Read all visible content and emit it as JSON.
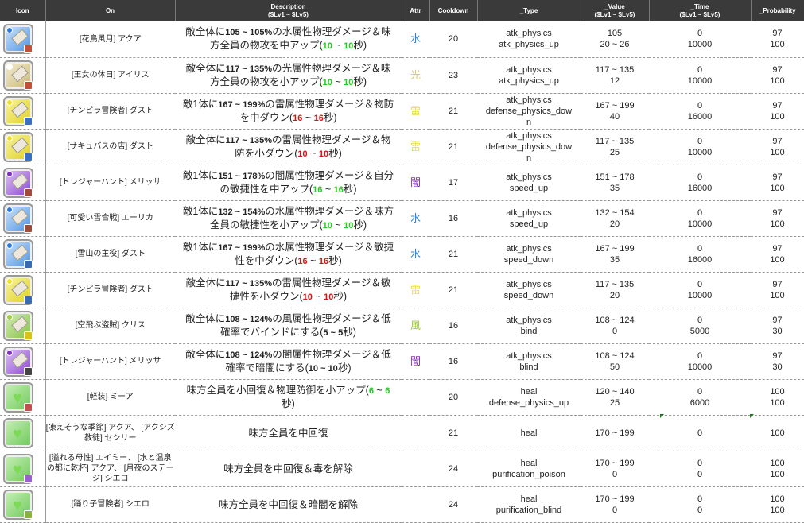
{
  "headers": {
    "icon": "Icon",
    "on": "On",
    "desc": "Description",
    "desc_sub": "($Lv1 ~ $Lv5)",
    "attr": "Attr",
    "cooldown": "Cooldown",
    "type": "_Type",
    "value": "_Value",
    "value_sub": "($Lv1 ~ $Lv5)",
    "time": "_Time",
    "time_sub": "($Lv1 ~ $Lv5)",
    "prob": "_Probability"
  },
  "colors": {
    "水": "#2e86d8",
    "光": "#d6c86a",
    "雷": "#ece040",
    "闇": "#8a2ec8",
    "風": "#9ccc3a",
    "heal": "#86d870"
  },
  "rows": [
    {
      "icon": "water",
      "badge": "#c0503a",
      "on": "[花鳥風月] アクア",
      "desc": [
        [
          "敵全体に",
          ""
        ],
        [
          "105 ~ 105%",
          "b"
        ],
        [
          "の水属性物理ダメージ＆味方全員の物攻を中アップ(",
          ""
        ],
        [
          "10",
          "g"
        ],
        [
          " ~ ",
          ""
        ],
        [
          "10",
          "g"
        ],
        [
          "秒)",
          ""
        ]
      ],
      "attr": "水",
      "cooldown": "20",
      "type": [
        "atk_physics",
        "atk_physics_up"
      ],
      "value": [
        "105",
        "20 ~ 26"
      ],
      "time": [
        "0",
        "10000"
      ],
      "prob": [
        "97",
        "100"
      ]
    },
    {
      "icon": "light",
      "badge": "#c0503a",
      "on": "[王女の休日] アイリス",
      "desc": [
        [
          "敵全体に",
          ""
        ],
        [
          "117 ~ 135%",
          "b"
        ],
        [
          "の光属性物理ダメージ＆味方全員の物攻を小アップ(",
          ""
        ],
        [
          "10",
          "g"
        ],
        [
          " ~ ",
          ""
        ],
        [
          "10",
          "g"
        ],
        [
          "秒)",
          ""
        ]
      ],
      "attr": "光",
      "cooldown": "23",
      "type": [
        "atk_physics",
        "atk_physics_up"
      ],
      "value": [
        "117 ~ 135",
        "12"
      ],
      "time": [
        "0",
        "10000"
      ],
      "prob": [
        "97",
        "100"
      ]
    },
    {
      "icon": "thunder",
      "badge": "#3a70c0",
      "on": "[チンピラ冒険者] ダスト",
      "desc": [
        [
          "敵1体に",
          ""
        ],
        [
          "167 ~ 199%",
          "b"
        ],
        [
          "の雷属性物理ダメージ＆物防を中ダウン(",
          ""
        ],
        [
          "16",
          "r"
        ],
        [
          " ~ ",
          ""
        ],
        [
          "16",
          "r"
        ],
        [
          "秒)",
          ""
        ]
      ],
      "attr": "雷",
      "cooldown": "21",
      "type": [
        "atk_physics",
        "defense_physics_dow",
        "n"
      ],
      "value": [
        "167 ~ 199",
        "40"
      ],
      "time": [
        "0",
        "16000"
      ],
      "prob": [
        "97",
        "100"
      ]
    },
    {
      "icon": "thunder",
      "badge": "#3a70c0",
      "on": "[サキュバスの店] ダスト",
      "desc": [
        [
          "敵全体に",
          ""
        ],
        [
          "117 ~ 135%",
          "b"
        ],
        [
          "の雷属性物理ダメージ＆物防を小ダウン(",
          ""
        ],
        [
          "10",
          "r"
        ],
        [
          " ~ ",
          ""
        ],
        [
          "10",
          "r"
        ],
        [
          "秒)",
          ""
        ]
      ],
      "attr": "雷",
      "cooldown": "21",
      "type": [
        "atk_physics",
        "defense_physics_dow",
        "n"
      ],
      "value": [
        "117 ~ 135",
        "25"
      ],
      "time": [
        "0",
        "10000"
      ],
      "prob": [
        "97",
        "100"
      ]
    },
    {
      "icon": "dark",
      "badge": "#a04a3a",
      "on": "[トレジャーハント] メリッサ",
      "desc": [
        [
          "敵1体に",
          ""
        ],
        [
          "151 ~ 178%",
          "b"
        ],
        [
          "の闇属性物理ダメージ＆自分の敏捷性を中アップ(",
          ""
        ],
        [
          "16",
          "g"
        ],
        [
          " ~ ",
          ""
        ],
        [
          "16",
          "g"
        ],
        [
          "秒)",
          ""
        ]
      ],
      "attr": "闇",
      "cooldown": "17",
      "type": [
        "atk_physics",
        "speed_up"
      ],
      "value": [
        "151 ~ 178",
        "35"
      ],
      "time": [
        "0",
        "16000"
      ],
      "prob": [
        "97",
        "100"
      ]
    },
    {
      "icon": "water",
      "badge": "#a04a3a",
      "on": "[可愛い雪合戦] エーリカ",
      "desc": [
        [
          "敵1体に",
          ""
        ],
        [
          "132 ~ 154%",
          "b"
        ],
        [
          "の水属性物理ダメージ＆味方全員の敏捷性を小アップ(",
          ""
        ],
        [
          "10",
          "g"
        ],
        [
          " ~ ",
          ""
        ],
        [
          "10",
          "g"
        ],
        [
          "秒)",
          ""
        ]
      ],
      "attr": "水",
      "cooldown": "16",
      "type": [
        "atk_physics",
        "speed_up"
      ],
      "value": [
        "132 ~ 154",
        "20"
      ],
      "time": [
        "0",
        "10000"
      ],
      "prob": [
        "97",
        "100"
      ]
    },
    {
      "icon": "water",
      "badge": "#3a6ab0",
      "on": "[雪山の主役] ダスト",
      "desc": [
        [
          "敵1体に",
          ""
        ],
        [
          "167 ~ 199%",
          "b"
        ],
        [
          "の水属性物理ダメージ＆敏捷性を中ダウン(",
          ""
        ],
        [
          "16",
          "r"
        ],
        [
          " ~ ",
          ""
        ],
        [
          "16",
          "r"
        ],
        [
          "秒)",
          ""
        ]
      ],
      "attr": "水",
      "cooldown": "21",
      "type": [
        "atk_physics",
        "speed_down"
      ],
      "value": [
        "167 ~ 199",
        "35"
      ],
      "time": [
        "0",
        "16000"
      ],
      "prob": [
        "97",
        "100"
      ]
    },
    {
      "icon": "thunder",
      "badge": "#3a6ab0",
      "on": "[チンピラ冒険者] ダスト",
      "desc": [
        [
          "敵全体に",
          ""
        ],
        [
          "117 ~ 135%",
          "b"
        ],
        [
          "の雷属性物理ダメージ＆敏捷性を小ダウン(",
          ""
        ],
        [
          "10",
          "r"
        ],
        [
          " ~ ",
          ""
        ],
        [
          "10",
          "r"
        ],
        [
          "秒)",
          ""
        ]
      ],
      "attr": "雷",
      "cooldown": "21",
      "type": [
        "atk_physics",
        "speed_down"
      ],
      "value": [
        "117 ~ 135",
        "20"
      ],
      "time": [
        "0",
        "10000"
      ],
      "prob": [
        "97",
        "100"
      ]
    },
    {
      "icon": "wind",
      "badge": "#d8c020",
      "on": "[空飛ぶ盗賊] クリス",
      "desc": [
        [
          "敵全体に",
          ""
        ],
        [
          "108 ~ 124%",
          "b"
        ],
        [
          "の風属性物理ダメージ＆低確率でバインドにする(",
          ""
        ],
        [
          "5 ~ 5",
          "b"
        ],
        [
          "秒)",
          ""
        ]
      ],
      "attr": "風",
      "cooldown": "16",
      "type": [
        "atk_physics",
        "bind"
      ],
      "value": [
        "108 ~ 124",
        "0"
      ],
      "time": [
        "0",
        "5000"
      ],
      "prob": [
        "97",
        "30"
      ]
    },
    {
      "icon": "dark",
      "badge": "#444444",
      "on": "[トレジャーハント] メリッサ",
      "desc": [
        [
          "敵全体に",
          ""
        ],
        [
          "108 ~ 124%",
          "b"
        ],
        [
          "の闇属性物理ダメージ＆低確率で暗闇にする(",
          ""
        ],
        [
          "10 ~ 10",
          "b"
        ],
        [
          "秒)",
          ""
        ]
      ],
      "attr": "闇",
      "cooldown": "16",
      "type": [
        "atk_physics",
        "blind"
      ],
      "value": [
        "108 ~ 124",
        "50"
      ],
      "time": [
        "0",
        "10000"
      ],
      "prob": [
        "97",
        "30"
      ]
    },
    {
      "icon": "heal",
      "badge": "#c05050",
      "on": "[軽装] ミーア",
      "desc": [
        [
          "味方全員を小回復＆物理防御を小アップ(",
          ""
        ],
        [
          "6",
          "g"
        ],
        [
          " ~ ",
          ""
        ],
        [
          "6",
          "g"
        ],
        [
          "秒)",
          ""
        ]
      ],
      "attr": "",
      "cooldown": "20",
      "type": [
        "heal",
        "defense_physics_up"
      ],
      "value": [
        "120 ~ 140",
        "25"
      ],
      "time": [
        "0",
        "6000"
      ],
      "prob": [
        "100",
        "100"
      ]
    },
    {
      "icon": "heal",
      "badge": "",
      "on": "[凍えそうな季節] アクア、 [アクシズ教徒] セシリー",
      "desc": [
        [
          "味方全員を中回復",
          ""
        ]
      ],
      "attr": "",
      "cooldown": "21",
      "type": [
        "heal"
      ],
      "value": [
        "170 ~ 199"
      ],
      "time": [
        "0"
      ],
      "prob": [
        "100"
      ]
    },
    {
      "icon": "heal",
      "badge": "#9a60d0",
      "on": "[溢れる母性] エイミー、 [水と温泉の都に乾杯] アクア、 [月夜のステージ] シエロ",
      "desc": [
        [
          "味方全員を中回復＆毒を解除",
          ""
        ]
      ],
      "attr": "",
      "cooldown": "24",
      "type": [
        "heal",
        "purification_poison"
      ],
      "value": [
        "170 ~ 199",
        "0"
      ],
      "time": [
        "0",
        "0"
      ],
      "prob": [
        "100",
        "100"
      ]
    },
    {
      "icon": "heal",
      "badge": "#8ab040",
      "on": "[踊り子冒険者] シエロ",
      "desc": [
        [
          "味方全員を中回復＆暗闇を解除",
          ""
        ]
      ],
      "attr": "",
      "cooldown": "24",
      "type": [
        "heal",
        "purification_blind"
      ],
      "value": [
        "170 ~ 199",
        "0"
      ],
      "time": [
        "0",
        "0"
      ],
      "prob": [
        "100",
        "100"
      ]
    }
  ]
}
